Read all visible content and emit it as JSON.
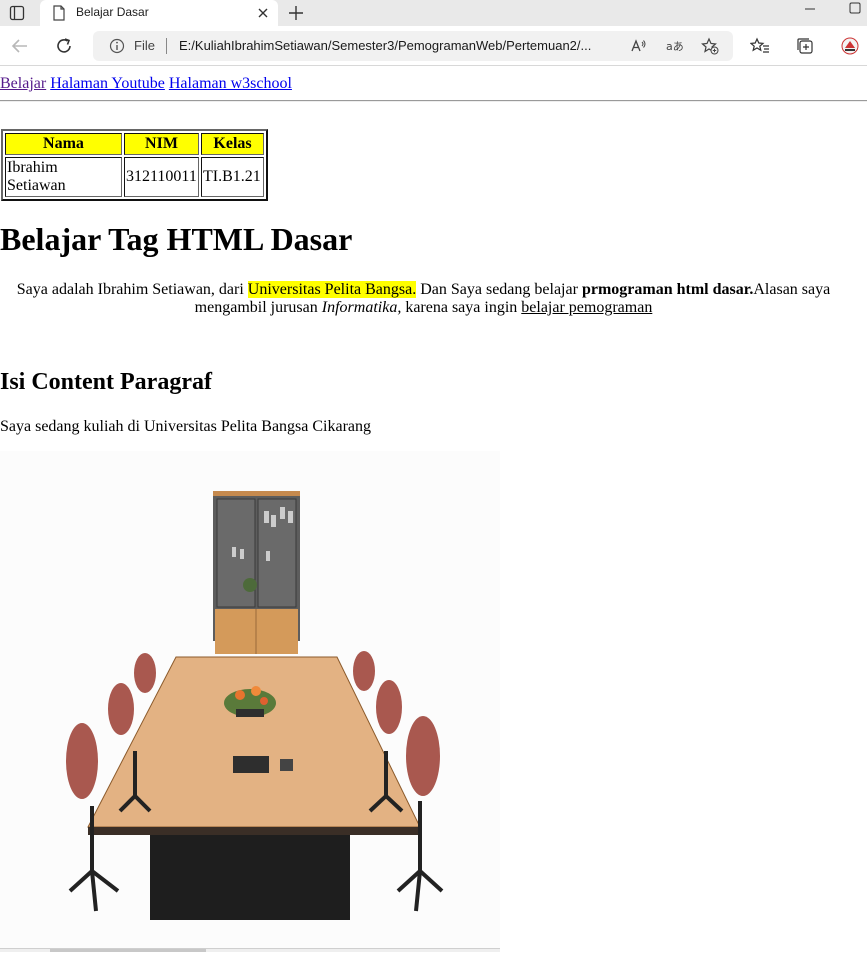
{
  "browser": {
    "tab_title": "Belajar Dasar",
    "file_label": "File",
    "url": "E:/KuliahIbrahimSetiawan/Semester3/PemogramanWeb/Pertemuan2/..."
  },
  "nav_links": [
    {
      "label": "Belajar"
    },
    {
      "label": "Halaman Youtube"
    },
    {
      "label": "Halaman w3school"
    }
  ],
  "table": {
    "headers": [
      "Nama",
      "NIM",
      "Kelas"
    ],
    "rows": [
      [
        "Ibrahim Setiawan",
        "312110011",
        "TI.B1.21"
      ]
    ],
    "header_color": "#ffff00"
  },
  "heading": "Belajar Tag HTML Dasar",
  "intro": {
    "part1": "Saya adalah Ibrahim Setiawan, dari ",
    "highlight": "Universitas Pelita Bangsa.",
    "part2": " Dan Saya sedang belajar ",
    "bold": "prmograman html dasar.",
    "part3": "Alasan saya mengambil jurusan ",
    "italic": "Informatika,",
    "part4": " karena saya ingin ",
    "underline": "belajar pemograman"
  },
  "subheading": "Isi Content Paragraf",
  "paragraph": "Saya sedang kuliah di Universitas Pelita Bangsa Cikarang",
  "colors": {
    "link": "#0000ee",
    "visited_link": "#551a8b",
    "highlight": "#ffff00"
  }
}
